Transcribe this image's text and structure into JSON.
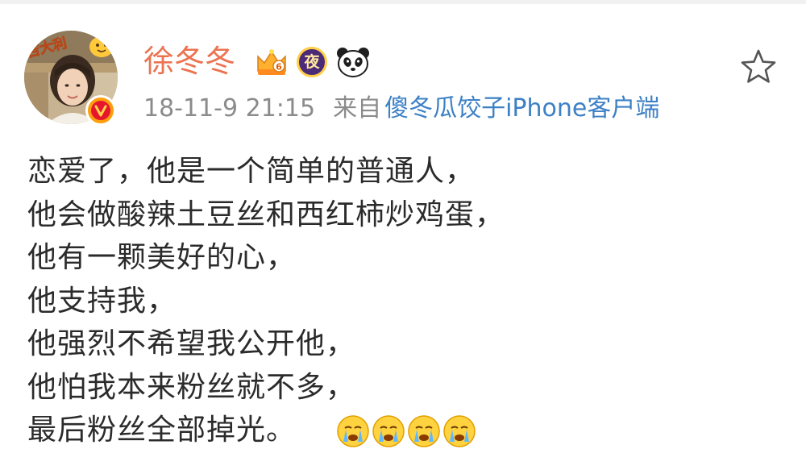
{
  "post": {
    "user": {
      "nickname": "徐冬冬",
      "avatar_icon": "avatar-photo",
      "avatar_caption": "吉大利",
      "verified_icon": "verified-v-icon",
      "badge_night": "夜"
    },
    "meta": {
      "time": "18-11-9 21:15",
      "from_label": "来自",
      "client": "傻冬瓜饺子iPhone客户端"
    },
    "favorite_icon": "star-outline-icon",
    "body_lines": [
      "恋爱了，他是一个简单的普通人，",
      "他会做酸辣土豆丝和西红柿炒鸡蛋，",
      "他有一颗美好的心，",
      "他支持我，",
      "他强烈不希望我公开他，",
      "他怕我本来粉丝就不多，",
      "最后粉丝全部掉光。"
    ],
    "emoji_icons": [
      "crying-emoji-icon",
      "crying-emoji-icon",
      "crying-emoji-icon",
      "crying-emoji-icon"
    ]
  },
  "colors": {
    "nickname": "#eb7350",
    "meta_gray": "#8b8b8b",
    "link_blue": "#3c80c5",
    "body_text": "#2b2b2b",
    "verified_orange": "#ff9e0d",
    "verified_red": "#e6162d"
  }
}
